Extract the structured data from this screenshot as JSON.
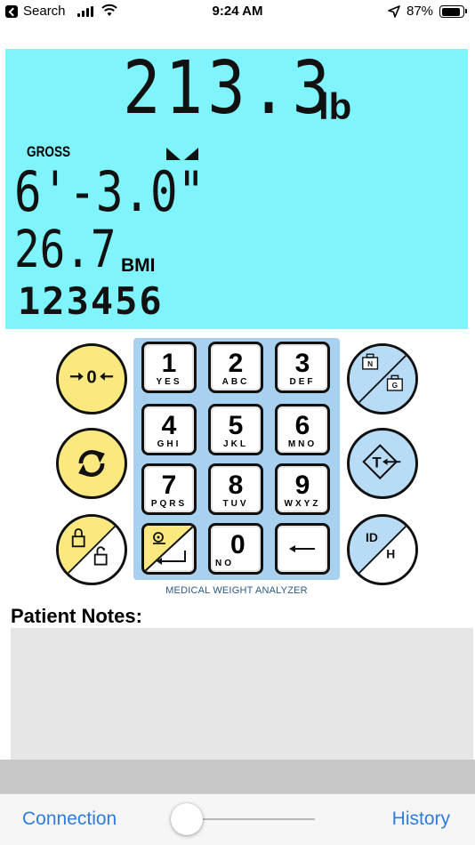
{
  "status_bar": {
    "carrier": "Search",
    "time": "9:24 AM",
    "battery_percent": "87%",
    "battery_level": 0.87
  },
  "display": {
    "weight": "213.3",
    "weight_unit": "lb",
    "mode": "GROSS",
    "height": "6'-3.0\"",
    "bmi": "26.7",
    "bmi_unit": "BMI",
    "patient_id": "123456"
  },
  "keypad": {
    "keys": [
      {
        "num": "1",
        "letters": "YES"
      },
      {
        "num": "2",
        "letters": "ABC"
      },
      {
        "num": "3",
        "letters": "DEF"
      },
      {
        "num": "4",
        "letters": "GHI"
      },
      {
        "num": "5",
        "letters": "JKL"
      },
      {
        "num": "6",
        "letters": "MNO"
      },
      {
        "num": "7",
        "letters": "PQRS"
      },
      {
        "num": "8",
        "letters": "TUV"
      },
      {
        "num": "9",
        "letters": "WXYZ"
      },
      {
        "num": "0",
        "letters": "NO"
      }
    ],
    "caption": "MEDICAL WEIGHT ANALYZER",
    "net_gross": {
      "top": "N",
      "bottom": "G"
    },
    "tare_letter": "T",
    "id_height": {
      "top": "ID",
      "bottom": "H"
    }
  },
  "icons": {
    "zero": "zero-icon",
    "refresh": "refresh-icon",
    "lock": "lock-unlock-icon",
    "print_enter": "print-enter-icon",
    "backspace": "backspace-icon"
  },
  "notes": {
    "label": "Patient Notes:",
    "value": ""
  },
  "toolbar": {
    "connection_label": "Connection",
    "history_label": "History",
    "slider_value": 0.1
  },
  "colors": {
    "lcd": "#7ff4fc",
    "keypad": "#a8d1ef",
    "yellow": "#fbe97f",
    "blue": "#b8dcf5",
    "accent": "#2f7be0"
  }
}
